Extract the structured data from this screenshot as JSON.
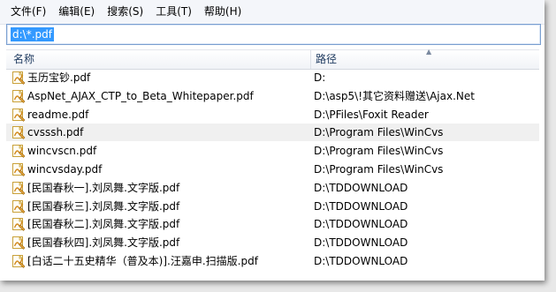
{
  "menu": [
    {
      "label": "文件(F)"
    },
    {
      "label": "编辑(E)"
    },
    {
      "label": "搜索(S)"
    },
    {
      "label": "工具(T)"
    },
    {
      "label": "帮助(H)"
    }
  ],
  "search": {
    "value": "d:\\*.pdf"
  },
  "columns": {
    "name": "名称",
    "path": "路径"
  },
  "icons": {
    "file": "pdf-file-icon",
    "sort": "sort-ascending-icon"
  },
  "rows": [
    {
      "name": "玉历宝钞.pdf",
      "path": "D:"
    },
    {
      "name": "AspNet_AJAX_CTP_to_Beta_Whitepaper.pdf",
      "path": "D:\\asp5\\!其它资料赠送\\Ajax.Net"
    },
    {
      "name": "readme.pdf",
      "path": "D:\\PFiles\\Foxit Reader"
    },
    {
      "name": "cvsssh.pdf",
      "path": "D:\\Program Files\\WinCvs"
    },
    {
      "name": "wincvscn.pdf",
      "path": "D:\\Program Files\\WinCvs"
    },
    {
      "name": "wincvsday.pdf",
      "path": "D:\\Program Files\\WinCvs"
    },
    {
      "name": "[民国春秋一].刘凤舞.文字版.pdf",
      "path": "D:\\TDDOWNLOAD"
    },
    {
      "name": "[民国春秋三].刘凤舞.文字版.pdf",
      "path": "D:\\TDDOWNLOAD"
    },
    {
      "name": "[民国春秋二].刘凤舞.文字版.pdf",
      "path": "D:\\TDDOWNLOAD"
    },
    {
      "name": "[民国春秋四].刘凤舞.文字版.pdf",
      "path": "D:\\TDDOWNLOAD"
    },
    {
      "name": "[白话二十五史精华（普及本)].汪嘉申.扫描版.pdf",
      "path": "D:\\TDDOWNLOAD"
    }
  ],
  "colors": {
    "selection": "#3399ff",
    "hover_row": "#f0f0f0",
    "header_text": "#1e3a5f"
  }
}
